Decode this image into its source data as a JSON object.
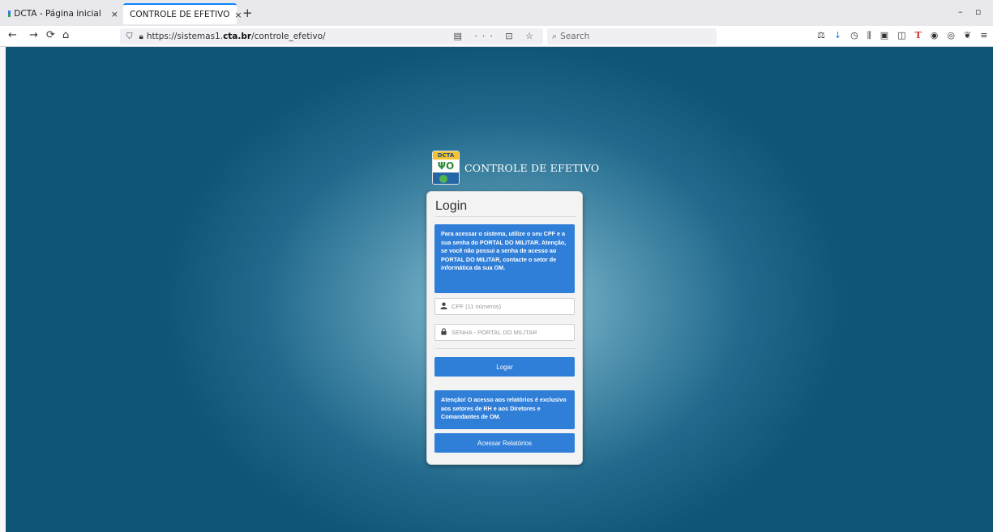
{
  "browser": {
    "tabs": [
      {
        "title": "DCTA - Página inicial",
        "close": "×",
        "favicon": "flag-icon"
      },
      {
        "title": "CONTROLE DE EFETIVO",
        "close": "×",
        "favicon": "site-icon"
      }
    ],
    "new_tab": "+",
    "window_controls": {
      "minimize": "–",
      "maximize": "▫"
    },
    "nav": {
      "back": "←",
      "forward": "→",
      "reload": "⟳",
      "home": "⌂"
    },
    "url": {
      "prefix": "https://sistemas1.",
      "domain": "cta.br",
      "path": "/controle_efetivo/"
    },
    "url_actions": "▤ ··· ⊡ ☆",
    "search": {
      "placeholder": "Search"
    },
    "toolbar_icons": [
      "⚖",
      "↓",
      "◷",
      "⫼",
      "▣",
      "◫",
      "T",
      "◉",
      "◎",
      "❦",
      "≡"
    ],
    "accent": "#0a84ff"
  },
  "page": {
    "brand": {
      "logo_text": "DCTA",
      "title": "CONTROLE DE EFETIVO"
    },
    "login": {
      "title": "Login",
      "info_text": "Para acessar o sistema, utilize o seu CPF e a sua senha do PORTAL DO MILITAR. Atenção, se você não possui a senha de acesso ao PORTAL DO MILITAR, contacte o setor de informática da sua OM.",
      "cpf": {
        "placeholder": "CPF (11 números)",
        "value": ""
      },
      "password": {
        "placeholder": "SENHA - PORTAL DO MILITAR",
        "value": ""
      },
      "login_button": "Logar",
      "reports_info": "Atenção! O acesso aos relatórios é exclusivo aos setores de RH e aos Diretores e Comandantes de OM.",
      "reports_button": "Acessar Relatórios"
    },
    "colors": {
      "primary": "#2f7ed8",
      "background": "#226a8d"
    }
  }
}
